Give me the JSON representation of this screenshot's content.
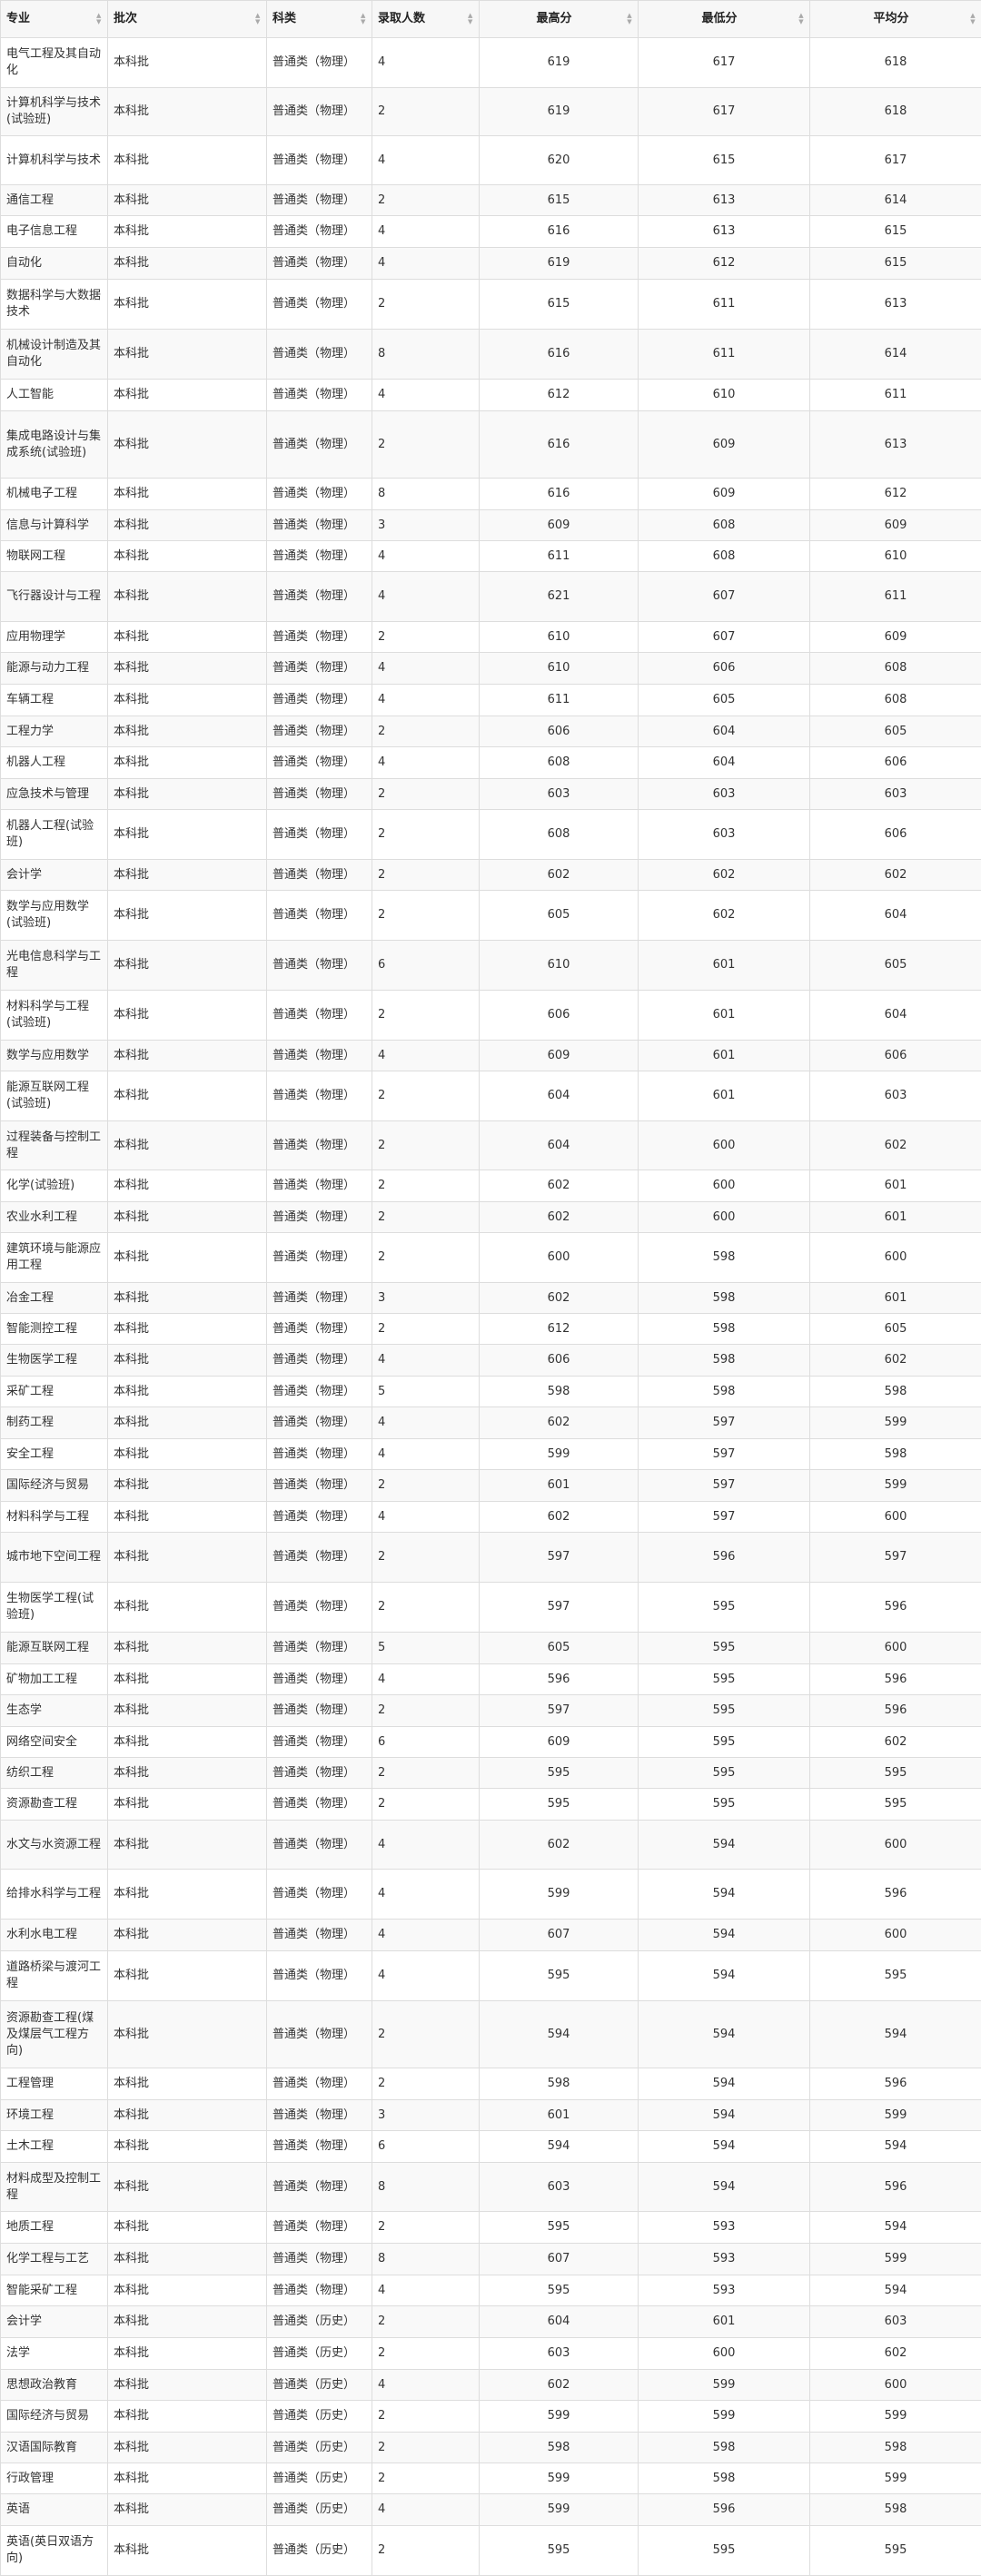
{
  "table": {
    "columns": [
      {
        "key": "major",
        "label": "专业"
      },
      {
        "key": "batch",
        "label": "批次"
      },
      {
        "key": "category",
        "label": "科类"
      },
      {
        "key": "admitted",
        "label": "录取人数"
      },
      {
        "key": "max",
        "label": "最高分"
      },
      {
        "key": "min",
        "label": "最低分"
      },
      {
        "key": "avg",
        "label": "平均分"
      }
    ],
    "rows": [
      [
        "电气工程及其自动化",
        "本科批",
        "普通类（物理）",
        "4",
        "619",
        "617",
        "618"
      ],
      [
        "计算机科学与技术(试验班)",
        "本科批",
        "普通类（物理）",
        "2",
        "619",
        "617",
        "618"
      ],
      [
        "计算机科学与技术",
        "本科批",
        "普通类（物理）",
        "4",
        "620",
        "615",
        "617"
      ],
      [
        "通信工程",
        "本科批",
        "普通类（物理）",
        "2",
        "615",
        "613",
        "614"
      ],
      [
        "电子信息工程",
        "本科批",
        "普通类（物理）",
        "4",
        "616",
        "613",
        "615"
      ],
      [
        "自动化",
        "本科批",
        "普通类（物理）",
        "4",
        "619",
        "612",
        "615"
      ],
      [
        "数据科学与大数据技术",
        "本科批",
        "普通类（物理）",
        "2",
        "615",
        "611",
        "613"
      ],
      [
        "机械设计制造及其自动化",
        "本科批",
        "普通类（物理）",
        "8",
        "616",
        "611",
        "614"
      ],
      [
        "人工智能",
        "本科批",
        "普通类（物理）",
        "4",
        "612",
        "610",
        "611"
      ],
      [
        "集成电路设计与集成系统(试验班)",
        "本科批",
        "普通类（物理）",
        "2",
        "616",
        "609",
        "613"
      ],
      [
        "机械电子工程",
        "本科批",
        "普通类（物理）",
        "8",
        "616",
        "609",
        "612"
      ],
      [
        "信息与计算科学",
        "本科批",
        "普通类（物理）",
        "3",
        "609",
        "608",
        "609"
      ],
      [
        "物联网工程",
        "本科批",
        "普通类（物理）",
        "4",
        "611",
        "608",
        "610"
      ],
      [
        "飞行器设计与工程",
        "本科批",
        "普通类（物理）",
        "4",
        "621",
        "607",
        "611"
      ],
      [
        "应用物理学",
        "本科批",
        "普通类（物理）",
        "2",
        "610",
        "607",
        "609"
      ],
      [
        "能源与动力工程",
        "本科批",
        "普通类（物理）",
        "4",
        "610",
        "606",
        "608"
      ],
      [
        "车辆工程",
        "本科批",
        "普通类（物理）",
        "4",
        "611",
        "605",
        "608"
      ],
      [
        "工程力学",
        "本科批",
        "普通类（物理）",
        "2",
        "606",
        "604",
        "605"
      ],
      [
        "机器人工程",
        "本科批",
        "普通类（物理）",
        "4",
        "608",
        "604",
        "606"
      ],
      [
        "应急技术与管理",
        "本科批",
        "普通类（物理）",
        "2",
        "603",
        "603",
        "603"
      ],
      [
        "机器人工程(试验班)",
        "本科批",
        "普通类（物理）",
        "2",
        "608",
        "603",
        "606"
      ],
      [
        "会计学",
        "本科批",
        "普通类（物理）",
        "2",
        "602",
        "602",
        "602"
      ],
      [
        "数学与应用数学(试验班)",
        "本科批",
        "普通类（物理）",
        "2",
        "605",
        "602",
        "604"
      ],
      [
        "光电信息科学与工程",
        "本科批",
        "普通类（物理）",
        "6",
        "610",
        "601",
        "605"
      ],
      [
        "材料科学与工程(试验班)",
        "本科批",
        "普通类（物理）",
        "2",
        "606",
        "601",
        "604"
      ],
      [
        "数学与应用数学",
        "本科批",
        "普通类（物理）",
        "4",
        "609",
        "601",
        "606"
      ],
      [
        "能源互联网工程(试验班)",
        "本科批",
        "普通类（物理）",
        "2",
        "604",
        "601",
        "603"
      ],
      [
        "过程装备与控制工程",
        "本科批",
        "普通类（物理）",
        "2",
        "604",
        "600",
        "602"
      ],
      [
        "化学(试验班)",
        "本科批",
        "普通类（物理）",
        "2",
        "602",
        "600",
        "601"
      ],
      [
        "农业水利工程",
        "本科批",
        "普通类（物理）",
        "2",
        "602",
        "600",
        "601"
      ],
      [
        "建筑环境与能源应用工程",
        "本科批",
        "普通类（物理）",
        "2",
        "600",
        "598",
        "600"
      ],
      [
        "冶金工程",
        "本科批",
        "普通类（物理）",
        "3",
        "602",
        "598",
        "601"
      ],
      [
        "智能测控工程",
        "本科批",
        "普通类（物理）",
        "2",
        "612",
        "598",
        "605"
      ],
      [
        "生物医学工程",
        "本科批",
        "普通类（物理）",
        "4",
        "606",
        "598",
        "602"
      ],
      [
        "采矿工程",
        "本科批",
        "普通类（物理）",
        "5",
        "598",
        "598",
        "598"
      ],
      [
        "制药工程",
        "本科批",
        "普通类（物理）",
        "4",
        "602",
        "597",
        "599"
      ],
      [
        "安全工程",
        "本科批",
        "普通类（物理）",
        "4",
        "599",
        "597",
        "598"
      ],
      [
        "国际经济与贸易",
        "本科批",
        "普通类（物理）",
        "2",
        "601",
        "597",
        "599"
      ],
      [
        "材料科学与工程",
        "本科批",
        "普通类（物理）",
        "4",
        "602",
        "597",
        "600"
      ],
      [
        "城市地下空间工程",
        "本科批",
        "普通类（物理）",
        "2",
        "597",
        "596",
        "597"
      ],
      [
        "生物医学工程(试验班)",
        "本科批",
        "普通类（物理）",
        "2",
        "597",
        "595",
        "596"
      ],
      [
        "能源互联网工程",
        "本科批",
        "普通类（物理）",
        "5",
        "605",
        "595",
        "600"
      ],
      [
        "矿物加工工程",
        "本科批",
        "普通类（物理）",
        "4",
        "596",
        "595",
        "596"
      ],
      [
        "生态学",
        "本科批",
        "普通类（物理）",
        "2",
        "597",
        "595",
        "596"
      ],
      [
        "网络空间安全",
        "本科批",
        "普通类（物理）",
        "6",
        "609",
        "595",
        "602"
      ],
      [
        "纺织工程",
        "本科批",
        "普通类（物理）",
        "2",
        "595",
        "595",
        "595"
      ],
      [
        "资源勘查工程",
        "本科批",
        "普通类（物理）",
        "2",
        "595",
        "595",
        "595"
      ],
      [
        "水文与水资源工程",
        "本科批",
        "普通类（物理）",
        "4",
        "602",
        "594",
        "600"
      ],
      [
        "给排水科学与工程",
        "本科批",
        "普通类（物理）",
        "4",
        "599",
        "594",
        "596"
      ],
      [
        "水利水电工程",
        "本科批",
        "普通类（物理）",
        "4",
        "607",
        "594",
        "600"
      ],
      [
        "道路桥梁与渡河工程",
        "本科批",
        "普通类（物理）",
        "4",
        "595",
        "594",
        "595"
      ],
      [
        "资源勘查工程(煤及煤层气工程方向)",
        "本科批",
        "普通类（物理）",
        "2",
        "594",
        "594",
        "594"
      ],
      [
        "工程管理",
        "本科批",
        "普通类（物理）",
        "2",
        "598",
        "594",
        "596"
      ],
      [
        "环境工程",
        "本科批",
        "普通类（物理）",
        "3",
        "601",
        "594",
        "599"
      ],
      [
        "土木工程",
        "本科批",
        "普通类（物理）",
        "6",
        "594",
        "594",
        "594"
      ],
      [
        "材料成型及控制工程",
        "本科批",
        "普通类（物理）",
        "8",
        "603",
        "594",
        "596"
      ],
      [
        "地质工程",
        "本科批",
        "普通类（物理）",
        "2",
        "595",
        "593",
        "594"
      ],
      [
        "化学工程与工艺",
        "本科批",
        "普通类（物理）",
        "8",
        "607",
        "593",
        "599"
      ],
      [
        "智能采矿工程",
        "本科批",
        "普通类（物理）",
        "4",
        "595",
        "593",
        "594"
      ],
      [
        "会计学",
        "本科批",
        "普通类（历史）",
        "2",
        "604",
        "601",
        "603"
      ],
      [
        "法学",
        "本科批",
        "普通类（历史）",
        "2",
        "603",
        "600",
        "602"
      ],
      [
        "思想政治教育",
        "本科批",
        "普通类（历史）",
        "4",
        "602",
        "599",
        "600"
      ],
      [
        "国际经济与贸易",
        "本科批",
        "普通类（历史）",
        "2",
        "599",
        "599",
        "599"
      ],
      [
        "汉语国际教育",
        "本科批",
        "普通类（历史）",
        "2",
        "598",
        "598",
        "598"
      ],
      [
        "行政管理",
        "本科批",
        "普通类（历史）",
        "2",
        "599",
        "598",
        "599"
      ],
      [
        "英语",
        "本科批",
        "普通类（历史）",
        "4",
        "599",
        "596",
        "598"
      ],
      [
        "英语(英日双语方向)",
        "本科批",
        "普通类（历史）",
        "2",
        "595",
        "595",
        "595"
      ]
    ]
  }
}
